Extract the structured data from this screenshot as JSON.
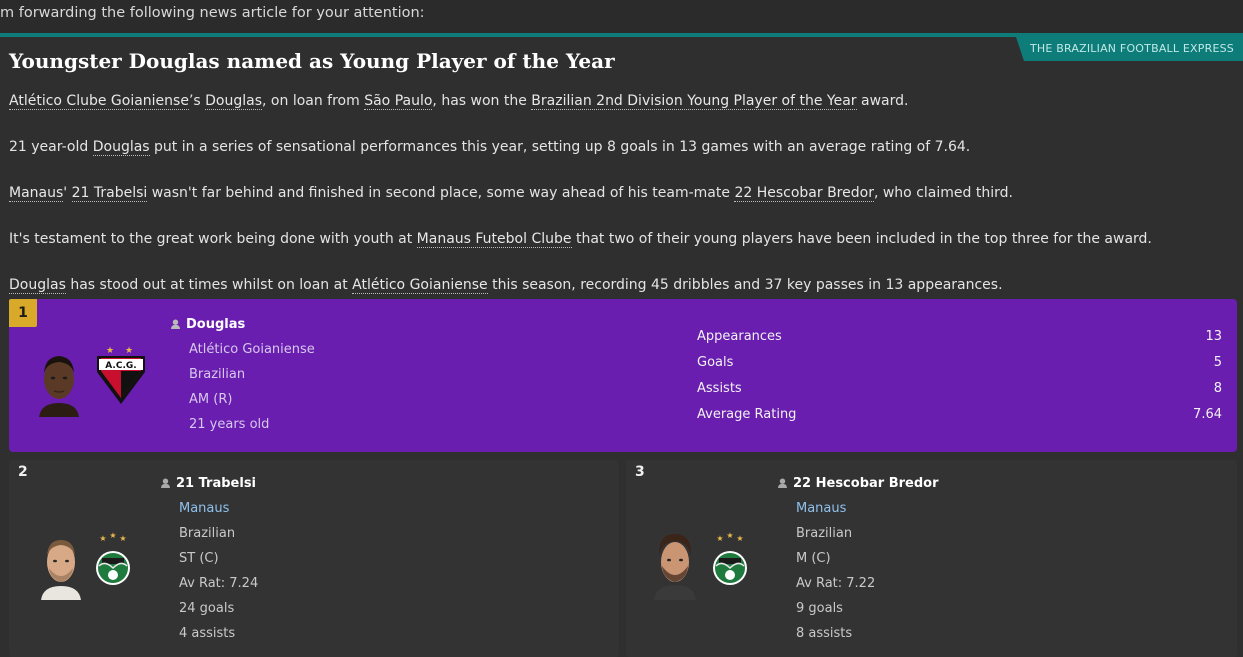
{
  "intro": "m forwarding the following news article for your attention:",
  "source": "THE BRAZILIAN FOOTBALL EXPRESS",
  "headline": "Youngster Douglas named as Young Player of the Year",
  "p1": {
    "club": "Atlético Clube Goianiense",
    "s1": "’s ",
    "player": "Douglas",
    "s2": ", on loan from ",
    "loan_club": "São Paulo",
    "s3": ", has won the ",
    "award": "Brazilian 2nd Division Young Player of the Year",
    "s4": " award."
  },
  "p2": {
    "s1": "21 year-old ",
    "player": "Douglas",
    "s2": " put in a series of sensational performances this year, setting up 8 goals in 13 games with an average rating of 7.64."
  },
  "p3": {
    "club": "Manaus",
    "s1": "' ",
    "player2": "21 Trabelsi",
    "s2": " wasn't far behind and finished in second place, some way ahead of his team-mate ",
    "player3": "22 Hescobar Bredor",
    "s3": ", who claimed third."
  },
  "p4": {
    "s1": "It's testament to the great work being done with youth at ",
    "club": "Manaus Futebol Clube",
    "s2": " that two of their young players have been included in the top three for the award."
  },
  "p5": {
    "player": "Douglas",
    "s1": " has stood out at times whilst on loan at ",
    "club": "Atlético Goianiense",
    "s2": " this season, recording 45 dribbles and 37 key passes in 13 appearances."
  },
  "winner": {
    "rank": "1",
    "name": "Douglas",
    "club": "Atlético Goianiense",
    "nationality": "Brazilian",
    "position": "AM (R)",
    "age": "21 years old",
    "badge_text": "A.C.G.",
    "stats": [
      {
        "label": "Appearances",
        "value": "13"
      },
      {
        "label": "Goals",
        "value": "5"
      },
      {
        "label": "Assists",
        "value": "8"
      },
      {
        "label": "Average Rating",
        "value": "7.64"
      }
    ]
  },
  "runners": [
    {
      "rank": "2",
      "name": "21 Trabelsi",
      "club": "Manaus",
      "nationality": "Brazilian",
      "position": "ST (C)",
      "rating": "Av Rat: 7.24",
      "goals": "24 goals",
      "assists": "4 assists"
    },
    {
      "rank": "3",
      "name": "22 Hescobar Bredor",
      "club": "Manaus",
      "nationality": "Brazilian",
      "position": "M (C)",
      "rating": "Av Rat: 7.22",
      "goals": "9 goals",
      "assists": "8 assists"
    }
  ],
  "colors": {
    "accent_teal": "#0e7d7a",
    "winner_purple": "#6a1eb0",
    "rank_gold": "#d9a92a",
    "club_link_blue": "#8fc1ec"
  }
}
